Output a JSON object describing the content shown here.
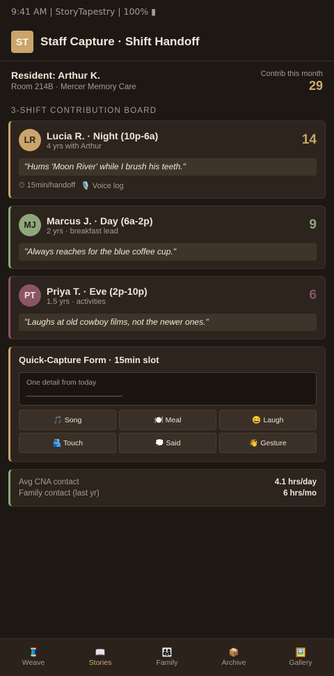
{
  "status_bar": {
    "text": "9:41 AM | StoryTapestry | 100% ▮"
  },
  "header": {
    "logo": "ST",
    "title": "Staff Capture · Shift Handoff"
  },
  "resident": {
    "name": "Resident: Arthur K.",
    "room": "Room 214B · Mercer Memory Care",
    "contrib_label": "Contrib this month",
    "contrib_value": "29"
  },
  "board_title": "3-SHIFT CONTRIBUTION BOARD",
  "staff": [
    {
      "initials": "LR",
      "name": "Lucia R. · Night (10p-6a)",
      "sub": "4 yrs with Arthur",
      "count": "14",
      "quote": "\"Hums 'Moon River' while I brush his teeth.\"",
      "meta_time": "⏱ 15min/handoff",
      "meta_voice": "🎙️ Voice log",
      "color": "#c9a56c"
    },
    {
      "initials": "MJ",
      "name": "Marcus J. · Day (6a-2p)",
      "sub": "2 yrs · breakfast lead",
      "count": "9",
      "quote": "\"Always reaches for the blue coffee cup.\"",
      "color": "#8fa87b"
    },
    {
      "initials": "PT",
      "name": "Priya T. · Eve (2p-10p)",
      "sub": "1.5 yrs · activities",
      "count": "6",
      "quote": "\"Laughs at old cowboy films, not the newer ones.\"",
      "color": "#8b5566"
    }
  ],
  "form": {
    "title": "Quick-Capture Form · 15min slot",
    "field_label": "One detail from today",
    "tags": [
      {
        "icon": "🎵",
        "label": "Song"
      },
      {
        "icon": "🍽️",
        "label": "Meal"
      },
      {
        "icon": "😄",
        "label": "Laugh"
      },
      {
        "icon": "🫂",
        "label": "Touch"
      },
      {
        "icon": "💭",
        "label": "Said"
      },
      {
        "icon": "👋",
        "label": "Gesture"
      }
    ]
  },
  "stats": [
    {
      "label": "Avg CNA contact",
      "value": "4.1 hrs/day"
    },
    {
      "label": "Family contact (last yr)",
      "value": "6 hrs/mo"
    }
  ],
  "nav": [
    {
      "icon": "🧵",
      "label": "Weave"
    },
    {
      "icon": "📖",
      "label": "Stories"
    },
    {
      "icon": "👨‍👩‍👧",
      "label": "Family"
    },
    {
      "icon": "📦",
      "label": "Archive"
    },
    {
      "icon": "🖼️",
      "label": "Gallery"
    }
  ],
  "nav_active": "Stories"
}
